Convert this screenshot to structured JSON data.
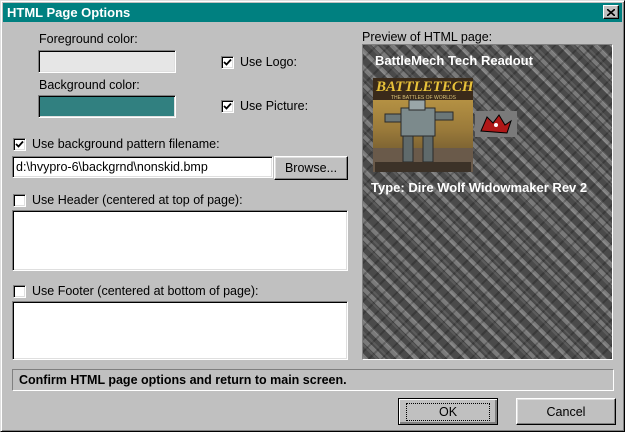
{
  "window": {
    "title": "HTML Page Options"
  },
  "colors": {
    "titlebar": "#008080",
    "foreground_swatch": "#e6e6e6",
    "background_swatch": "#318080",
    "window_bg": "#c0c0c0"
  },
  "options": {
    "foreground_label": "Foreground color:",
    "background_label": "Background color:",
    "use_logo": {
      "label": "Use Logo:",
      "checked": true
    },
    "use_picture": {
      "label": "Use Picture:",
      "checked": true
    },
    "use_bg_pattern": {
      "label": "Use background pattern filename:",
      "checked": true
    },
    "bg_pattern_path": "d:\\hvypro-6\\backgrnd\\nonskid.bmp",
    "browse_label": "Browse...",
    "use_header": {
      "label": "Use Header (centered at top of page):",
      "checked": false,
      "value": ""
    },
    "use_footer": {
      "label": "Use Footer (centered at bottom of page):",
      "checked": false,
      "value": ""
    }
  },
  "preview": {
    "label": "Preview of HTML page:",
    "page_title": "BattleMech Tech Readout",
    "logo_text": "BATTLETECH",
    "logo_subtitle": "THE BATTLES OF WORLDS",
    "type_line": "Type: Dire Wolf Widowmaker Rev 2"
  },
  "status_text": "Confirm HTML page options and return to main screen.",
  "buttons": {
    "ok": "OK",
    "cancel": "Cancel"
  },
  "icons": {
    "close": "close-icon",
    "checkmark": "check-icon"
  }
}
